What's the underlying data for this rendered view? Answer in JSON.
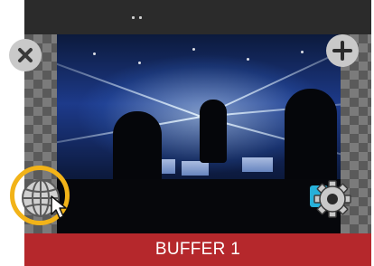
{
  "tile": {
    "label": "BUFFER 1"
  },
  "buttons": {
    "close_icon": "close-icon",
    "add_icon": "plus-icon",
    "globe_icon": "globe-icon",
    "settings_icon": "gear-icon"
  },
  "colors": {
    "label_bar": "#b5282c",
    "highlight_ring": "#f2b318",
    "badge": "#27b0d9"
  }
}
